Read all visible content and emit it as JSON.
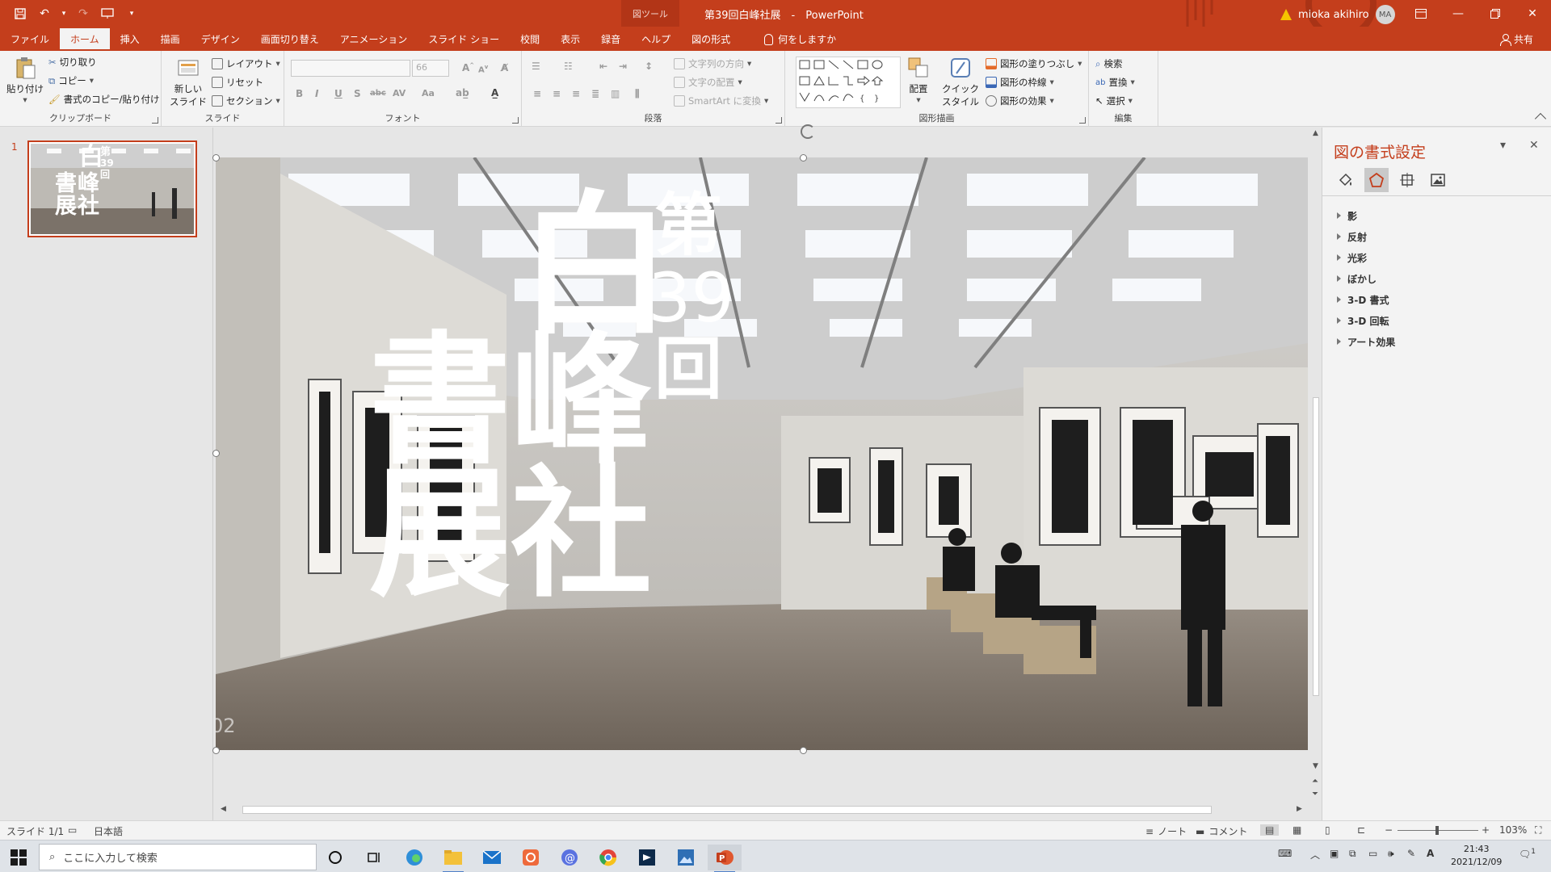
{
  "titlebar": {
    "context_tab": "図ツール",
    "doc_title": "第39回白峰社展　-　PowerPoint",
    "user_name": "mioka akihiro",
    "user_initials": "MA"
  },
  "tabs": [
    "ファイル",
    "ホーム",
    "挿入",
    "描画",
    "デザイン",
    "画面切り替え",
    "アニメーション",
    "スライド ショー",
    "校閲",
    "表示",
    "録音",
    "ヘルプ",
    "図の形式"
  ],
  "active_tab": "ホーム",
  "tell_me": "何をしますか",
  "share_label": "共有",
  "ribbon": {
    "clipboard": {
      "label": "クリップボード",
      "paste": "貼り付け",
      "cut": "切り取り",
      "copy": "コピー",
      "format_painter": "書式のコピー/貼り付け"
    },
    "slides": {
      "label": "スライド",
      "new_slide_1": "新しい",
      "new_slide_2": "スライド",
      "layout": "レイアウト",
      "reset": "リセット",
      "section": "セクション"
    },
    "font": {
      "label": "フォント",
      "size": "66",
      "bold": "B",
      "italic": "I",
      "underline": "U",
      "shadow": "S",
      "strike": "abc",
      "spacing": "AV",
      "case": "Aa"
    },
    "paragraph": {
      "label": "段落",
      "text_direction": "文字列の方向",
      "align_text": "文字の配置",
      "smartart": "SmartArt に変換"
    },
    "drawing": {
      "label": "図形描画",
      "arrange": "配置",
      "quick_styles_1": "クイック",
      "quick_styles_2": "スタイル",
      "fill": "図形の塗りつぶし",
      "outline": "図形の枠線",
      "effects": "図形の効果"
    },
    "editing": {
      "label": "編集",
      "find": "検索",
      "replace": "置換",
      "select": "選択"
    }
  },
  "slide_panel": {
    "number": "1"
  },
  "slide": {
    "title_chars": {
      "c1": "白",
      "c2": "第",
      "c3": "39",
      "c4": "回",
      "c5": "書",
      "c6": "峰",
      "c7": "展",
      "c8": "社"
    },
    "slide_number_fragment": "02"
  },
  "format_pane": {
    "title": "図の書式設定",
    "items": [
      "影",
      "反射",
      "光彩",
      "ぼかし",
      "3-D 書式",
      "3-D 回転",
      "アート効果"
    ]
  },
  "status": {
    "slide_info": "スライド 1/1",
    "language": "日本語",
    "notes": "ノート",
    "comments": "コメント",
    "zoom": "103%"
  },
  "taskbar": {
    "search_placeholder": "ここに入力して検索",
    "time": "21:43",
    "date": "2021/12/09",
    "notification_count": "1"
  },
  "colors": {
    "accent": "#c43e1c"
  }
}
